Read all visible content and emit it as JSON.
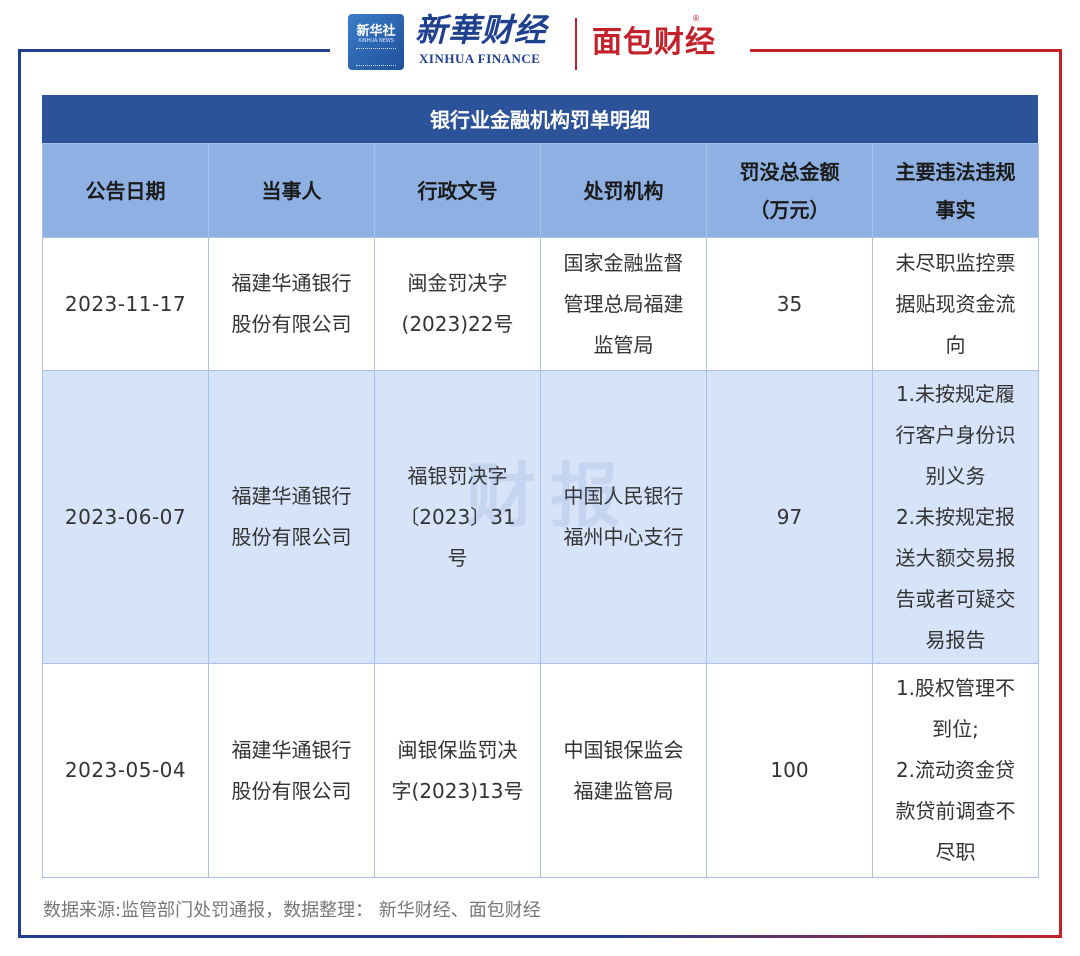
{
  "header": {
    "logo_xinhuashe_cn": "新华社",
    "logo_xinhuashe_en": "XINHUA NEWS",
    "logo_xhfin_cn": "新華财经",
    "logo_xhfin_en": "XINHUA FINANCE",
    "logo_mbfin_cn": "面包财经",
    "logo_mbfin_reg": "®"
  },
  "table": {
    "title": "银行业金融机构罚单明细",
    "columns": [
      "公告日期",
      "当事人",
      "行政文号",
      "处罚机构",
      "罚没总金额\n（万元）",
      "主要违法违规\n事实"
    ],
    "rows": [
      {
        "date": "2023-11-17",
        "party": "福建华通银行\n股份有限公司",
        "doc_no": "闽金罚决字\n(2023)22号",
        "agency": "国家金融监督\n管理总局福建\n监管局",
        "amount": "35",
        "facts": "未尽职监控票\n据贴现资金流\n向"
      },
      {
        "date": "2023-06-07",
        "party": "福建华通银行\n股份有限公司",
        "doc_no": "福银罚决字\n〔2023〕31\n号",
        "agency": "中国人民银行\n福州中心支行",
        "amount": "97",
        "facts": "1.未按规定履\n行客户身份识\n别义务\n2.未按规定报\n送大额交易报\n告或者可疑交\n易报告"
      },
      {
        "date": "2023-05-04",
        "party": "福建华通银行\n股份有限公司",
        "doc_no": "闽银保监罚决\n字(2023)13号",
        "agency": "中国银保监会\n福建监管局",
        "amount": "100",
        "facts": "1.股权管理不\n到位;\n2.流动资金贷\n款贷前调查不\n尽职"
      }
    ]
  },
  "watermark": "财报",
  "footer": {
    "source": "数据来源:监管部门处罚通报，数据整理： 新华财经、面包财经"
  },
  "colors": {
    "title_bar": "#2c5299",
    "header_row": "#8eb0e3",
    "highlight_row": "#d6e3f8",
    "frame_blue": "#1f3f8f",
    "frame_red": "#c4222b"
  }
}
